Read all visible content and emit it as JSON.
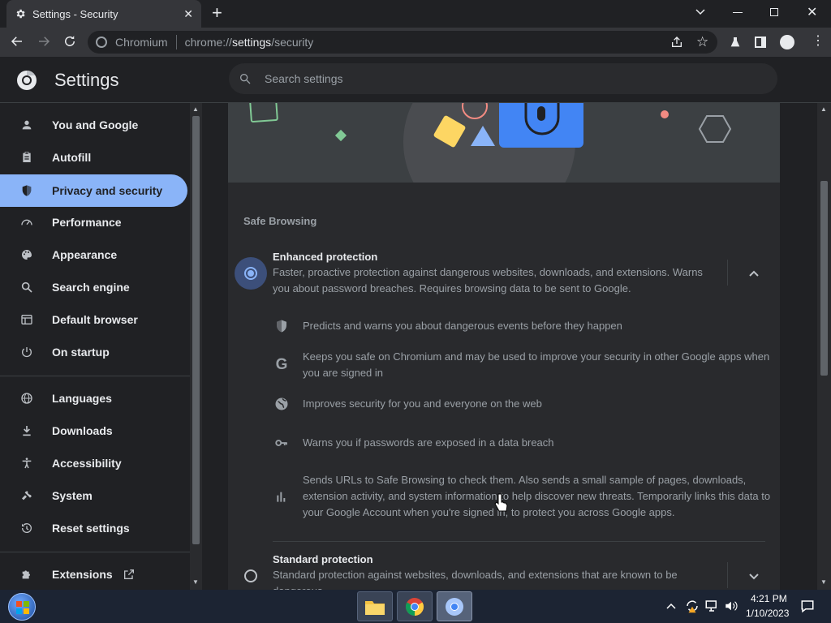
{
  "tab": {
    "title": "Settings - Security"
  },
  "omnibox": {
    "scheme_label": "Chromium",
    "url_prefix": "chrome://",
    "url_host": "settings",
    "url_path": "/security"
  },
  "header": {
    "title": "Settings",
    "search_placeholder": "Search settings"
  },
  "sidebar": {
    "items": [
      {
        "label": "You and Google",
        "icon": "person-icon"
      },
      {
        "label": "Autofill",
        "icon": "clipboard-icon"
      },
      {
        "label": "Privacy and security",
        "icon": "shield-icon"
      },
      {
        "label": "Performance",
        "icon": "gauge-icon"
      },
      {
        "label": "Appearance",
        "icon": "palette-icon"
      },
      {
        "label": "Search engine",
        "icon": "search-icon"
      },
      {
        "label": "Default browser",
        "icon": "browser-icon"
      },
      {
        "label": "On startup",
        "icon": "power-icon"
      },
      {
        "label": "Languages",
        "icon": "globe-icon"
      },
      {
        "label": "Downloads",
        "icon": "download-icon"
      },
      {
        "label": "Accessibility",
        "icon": "accessibility-icon"
      },
      {
        "label": "System",
        "icon": "wrench-icon"
      },
      {
        "label": "Reset settings",
        "icon": "history-icon"
      },
      {
        "label": "Extensions",
        "icon": "puzzle-icon"
      }
    ]
  },
  "safe_browsing": {
    "section_title": "Safe Browsing",
    "enhanced": {
      "title": "Enhanced protection",
      "description": "Faster, proactive protection against dangerous websites, downloads, and extensions. Warns you about password breaches. Requires browsing data to be sent to Google.",
      "bullets": [
        {
          "text": "Predicts and warns you about dangerous events before they happen",
          "icon": "shield-icon"
        },
        {
          "text": "Keeps you safe on Chromium and may be used to improve your security in other Google apps when you are signed in",
          "icon": "google-g-icon"
        },
        {
          "text": "Improves security for you and everyone on the web",
          "icon": "globe-icon"
        },
        {
          "text": "Warns you if passwords are exposed in a data breach",
          "icon": "key-icon"
        },
        {
          "text": "Sends URLs to Safe Browsing to check them. Also sends a small sample of pages, downloads, extension activity, and system information to help discover new threats. Temporarily links this data to your Google Account when you're signed in, to protect you across Google apps.",
          "icon": "bar-chart-icon"
        }
      ]
    },
    "standard": {
      "title": "Standard protection",
      "description": "Standard protection against websites, downloads, and extensions that are known to be dangerous."
    }
  },
  "taskbar": {
    "time": "4:21 PM",
    "date": "1/10/2023"
  },
  "colors": {
    "accent": "#8ab4f8",
    "background": "#202124",
    "card": "#292a2d"
  }
}
